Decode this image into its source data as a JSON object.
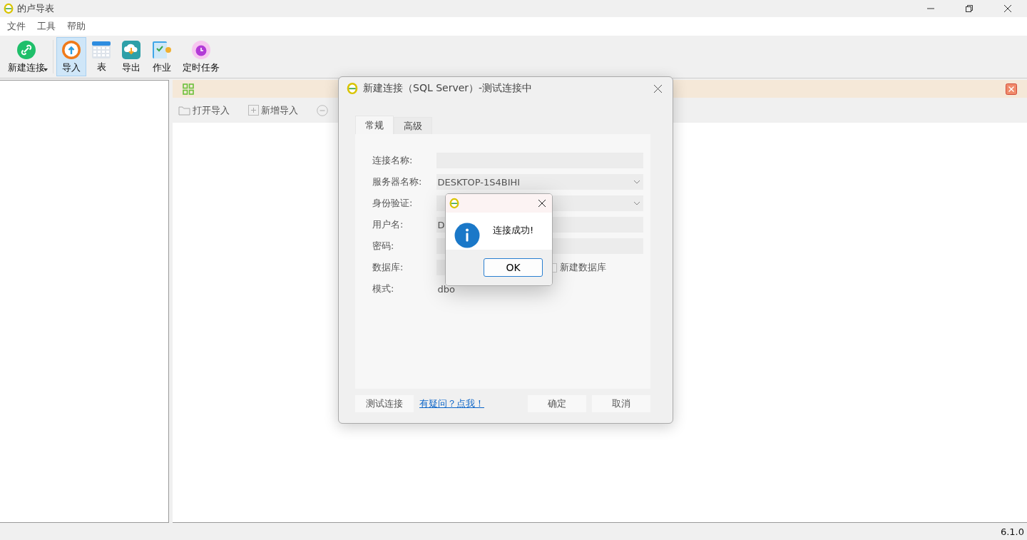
{
  "window": {
    "title": "的卢导表"
  },
  "menu": [
    "文件",
    "工具",
    "帮助"
  ],
  "toolbar": [
    {
      "label": "新建连接",
      "kind": "link",
      "selected": false,
      "dropdown": true
    },
    {
      "label": "导入",
      "kind": "import",
      "selected": true,
      "dropdown": false
    },
    {
      "label": "表",
      "kind": "table",
      "selected": false,
      "dropdown": false
    },
    {
      "label": "导出",
      "kind": "export",
      "selected": false,
      "dropdown": false
    },
    {
      "label": "作业",
      "kind": "job",
      "selected": false,
      "dropdown": false
    },
    {
      "label": "定时任务",
      "kind": "timer",
      "selected": false,
      "dropdown": false
    }
  ],
  "import_panel": {
    "actions": [
      {
        "label": "打开导入",
        "kind": "folder"
      },
      {
        "label": "新增导入",
        "kind": "add"
      },
      {
        "kind": "remove"
      }
    ]
  },
  "dialog": {
    "title": "新建连接（SQL Server）-测试连接中",
    "tabs": [
      {
        "label": "常规",
        "selected": true
      },
      {
        "label": "高级",
        "selected": false
      }
    ],
    "fields": [
      {
        "label": "连接名称:",
        "kind": "text"
      },
      {
        "label": "服务器名称:",
        "kind": "combo",
        "value": "DESKTOP-1S4BIHI"
      },
      {
        "label": "身份验证:",
        "kind": "combo"
      },
      {
        "label": "用户名:",
        "kind": "text",
        "value": "D"
      },
      {
        "label": "密码:",
        "kind": "text"
      },
      {
        "label": "数据库:",
        "kind": "text",
        "checkbox": {
          "label": "新建数据库",
          "checked": false
        }
      },
      {
        "label": "模式:",
        "kind": "plain",
        "value": "dbo"
      }
    ],
    "test_button": "测试连接",
    "help_link": "有疑问？点我！",
    "ok_button": "确定",
    "cancel_button": "取消"
  },
  "message_box": {
    "kind": "info",
    "text": "连接成功!",
    "button": "OK"
  },
  "status_bar": {
    "version": "6.1.0"
  }
}
